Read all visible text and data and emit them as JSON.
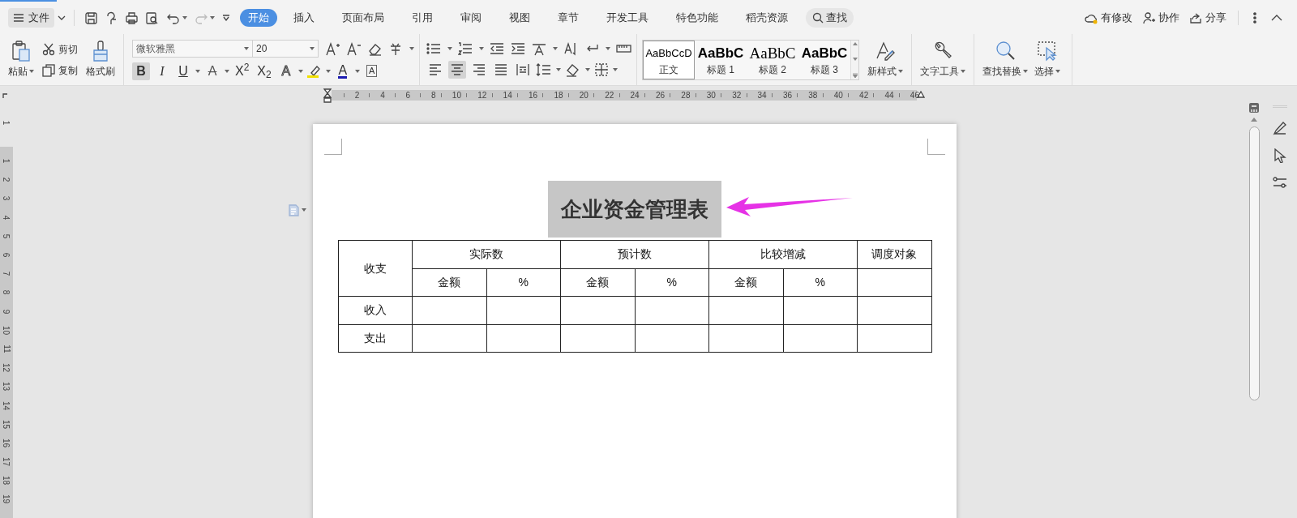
{
  "menu": {
    "label": "文件"
  },
  "tabs": [
    {
      "label": "开始",
      "selected": true
    },
    {
      "label": "插入",
      "selected": false
    },
    {
      "label": "页面布局",
      "selected": false
    },
    {
      "label": "引用",
      "selected": false
    },
    {
      "label": "审阅",
      "selected": false
    },
    {
      "label": "视图",
      "selected": false
    },
    {
      "label": "章节",
      "selected": false
    },
    {
      "label": "开发工具",
      "selected": false
    },
    {
      "label": "特色功能",
      "selected": false
    },
    {
      "label": "稻壳资源",
      "selected": false
    }
  ],
  "search": {
    "label": "查找"
  },
  "top_actions": [
    {
      "label": "有修改",
      "kind": "cloud"
    },
    {
      "label": "协作",
      "kind": "collab"
    },
    {
      "label": "分享",
      "kind": "share"
    }
  ],
  "clipboard": {
    "paste": "粘贴",
    "cut": "剪切",
    "copy": "复制",
    "format_painter": "格式刷"
  },
  "font": {
    "family": "微软雅黑",
    "size": "20"
  },
  "font_buttons": [
    {
      "label": "B",
      "kind": "bold",
      "selected": true
    },
    {
      "label": "I",
      "kind": "italic",
      "selected": false
    },
    {
      "label": "U",
      "kind": "underline",
      "selected": false
    },
    {
      "label": "A",
      "kind": "strike",
      "selected": false
    },
    {
      "label": "X$^{2}$",
      "kind": "sup",
      "selected": false
    },
    {
      "label": "X$_{2}$",
      "kind": "sub",
      "selected": false
    },
    {
      "label": "A",
      "kind": "effect",
      "selected": false
    },
    {
      "label": "A",
      "kind": "color",
      "selected": false
    },
    {
      "label": "A",
      "kind": "boxed",
      "selected": false
    }
  ],
  "align_buttons": [
    {
      "kind": "left",
      "selected": false
    },
    {
      "kind": "center",
      "selected": true
    },
    {
      "kind": "right",
      "selected": false
    },
    {
      "kind": "justify",
      "selected": false
    },
    {
      "kind": "distribute",
      "selected": false
    }
  ],
  "styles": [
    {
      "preview": "AaBbCcD",
      "label": "正文",
      "kind": "body",
      "selected": true
    },
    {
      "preview": "AaBbC",
      "label": "标题 1",
      "kind": "h1",
      "selected": false
    },
    {
      "preview": "AaBbC",
      "label": "标题 2",
      "kind": "h2",
      "selected": false
    },
    {
      "preview": "AaBbC",
      "label": "标题 3",
      "kind": "h3",
      "selected": false
    }
  ],
  "tools": [
    {
      "label": "新样式",
      "kind": "newstyle"
    },
    {
      "label": "文字工具",
      "kind": "wrench"
    },
    {
      "label": "查找替换",
      "kind": "find"
    },
    {
      "label": "选择",
      "kind": "select"
    }
  ],
  "ruler": {
    "labels": [
      "2",
      "4",
      "6",
      "8",
      "10",
      "12",
      "14",
      "16",
      "18",
      "20",
      "22",
      "24",
      "26",
      "28",
      "30",
      "32",
      "34",
      "36",
      "38",
      "40",
      "42",
      "44",
      "46"
    ]
  },
  "vertical_ruler": {
    "top_label": "1",
    "labels": [
      "1",
      "2",
      "3",
      "4",
      "5",
      "6",
      "7",
      "8",
      "9",
      "10",
      "11",
      "12",
      "13",
      "14",
      "15",
      "16",
      "17",
      "18",
      "19"
    ]
  },
  "document": {
    "title": "企业资金管理表",
    "title_highlighted": true,
    "table": {
      "header_top": [
        "收支",
        "实际数",
        "预计数",
        "比较增减",
        "调度对象"
      ],
      "header_sub": [
        "金额",
        "%",
        "金额",
        "%",
        "金额",
        "%"
      ],
      "rows": [
        [
          "收入",
          "",
          "",
          "",
          "",
          "",
          "",
          ""
        ],
        [
          "支出",
          "",
          "",
          "",
          "",
          "",
          "",
          ""
        ]
      ]
    }
  }
}
